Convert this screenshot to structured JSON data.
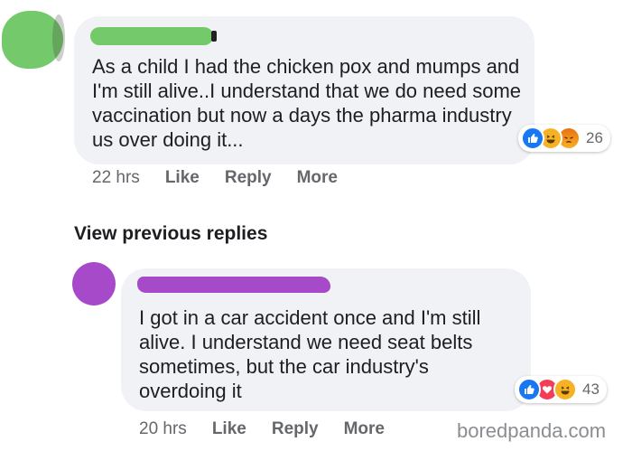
{
  "comment": {
    "text": "As a child I had the chicken pox and mumps and I'm still alive..I understand that we do need some vaccination but now a days the pharma industry us over doing it...",
    "reactions": {
      "icons": [
        "like-icon",
        "haha-icon",
        "angry-icon"
      ],
      "count": "26"
    },
    "actions": {
      "time": "22 hrs",
      "like": "Like",
      "reply": "Reply",
      "more": "More"
    },
    "avatar_color": "#74c96a"
  },
  "view_previous": "View previous replies",
  "reply": {
    "text": "I got in a car accident once and I'm still alive. I understand we need seat belts sometimes, but the car industry's overdoing it",
    "reactions": {
      "icons": [
        "like-icon",
        "love-icon",
        "haha-icon"
      ],
      "count": "43"
    },
    "actions": {
      "time": "20 hrs",
      "like": "Like",
      "reply": "Reply",
      "more": "More"
    },
    "avatar_color": "#a64ac9"
  },
  "watermark": "boredpanda.com",
  "colors": {
    "bubble": "#f0f2f5",
    "meta": "#65676b",
    "like_blue": "#1877f2",
    "love_red": "#f33e58",
    "haha_yellow": "#f7b125"
  }
}
